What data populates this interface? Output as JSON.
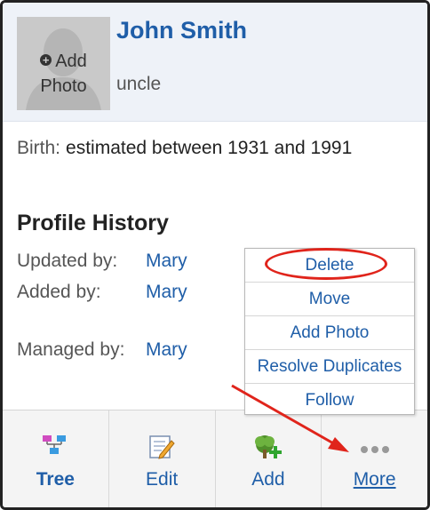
{
  "profile": {
    "photo_label_line1": "Add",
    "photo_label_line2": "Photo",
    "name": "John Smith",
    "relation": "uncle"
  },
  "birth": {
    "label": "Birth:",
    "value": "estimated between 1931 and 1991"
  },
  "history": {
    "title": "Profile History",
    "rows": [
      {
        "label": "Updated by:",
        "value": "Mary"
      },
      {
        "label": "Added by:",
        "value": "Mary"
      },
      {
        "label": "Managed by:",
        "value": "Mary"
      }
    ]
  },
  "menu": {
    "items": [
      "Delete",
      "Move",
      "Add Photo",
      "Resolve Duplicates",
      "Follow"
    ]
  },
  "toolbar": {
    "items": [
      {
        "label": "Tree",
        "icon": "tree-icon"
      },
      {
        "label": "Edit",
        "icon": "edit-icon"
      },
      {
        "label": "Add",
        "icon": "add-person-icon"
      },
      {
        "label": "More",
        "icon": "more-dots-icon"
      }
    ]
  },
  "colors": {
    "link": "#1f5ea8",
    "header_bg": "#eef2f8",
    "annotation": "#e0241b"
  }
}
